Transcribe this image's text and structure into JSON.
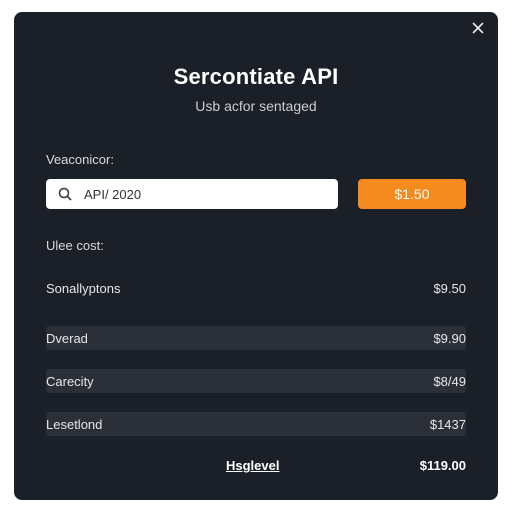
{
  "modal": {
    "close_icon": "close-icon",
    "title": "Sercontiate API",
    "subtitle": "Usb acfor sentaged"
  },
  "search": {
    "label": "Veaconicor:",
    "value": "API/ 2020",
    "icon": "search-icon"
  },
  "price_button": {
    "label": "$1.50",
    "color": "#f58a1f"
  },
  "cost": {
    "label": "Ulee cost:",
    "rows": [
      {
        "name": "Sonallyptons",
        "value": "$9.50"
      },
      {
        "name": "Dverad",
        "value": "$9.90"
      },
      {
        "name": "Carecity",
        "value": "$8/49"
      },
      {
        "name": "Lesetlond",
        "value": "$1437"
      }
    ]
  },
  "footer": {
    "label": "Hsglevel",
    "total": "$119.00"
  }
}
